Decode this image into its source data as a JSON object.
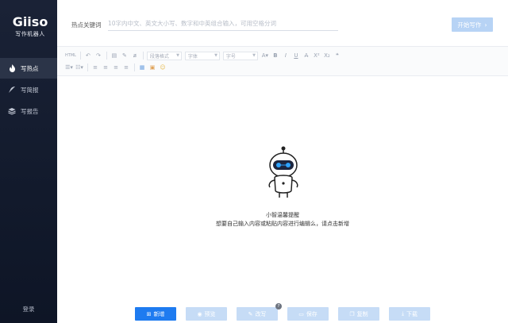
{
  "app": {
    "logo": "Giiso",
    "subtitle": "写作机器人"
  },
  "sidebar": {
    "items": [
      {
        "label": "写热点",
        "icon": "flame-icon",
        "active": true
      },
      {
        "label": "写简报",
        "icon": "feather-icon",
        "active": false
      },
      {
        "label": "写报告",
        "icon": "layers-icon",
        "active": false
      }
    ],
    "login": "登录"
  },
  "topbar": {
    "keyword_label": "热点关键词",
    "keyword_placeholder": "10字内中文、英文大小写、数字和中英组合输入，可用空格分词",
    "start_button": "开始写作"
  },
  "toolbar": {
    "html_label": "HTML",
    "paragraph_select": "段落格式",
    "font_select": "字体",
    "size_select": "字号"
  },
  "empty_state": {
    "title": "小智温馨提醒",
    "message": "想要自己输入内容或粘贴内容进行编辑么，请点击新增"
  },
  "actions": {
    "new": "新增",
    "preview": "预览",
    "rewrite": "改写",
    "rewrite_badge": "?",
    "save": "保存",
    "copy": "复制",
    "download": "下载"
  },
  "colors": {
    "sidebar_bg": "#151d30",
    "accent": "#1e7bf0",
    "accent_muted": "#c6dcf6"
  }
}
